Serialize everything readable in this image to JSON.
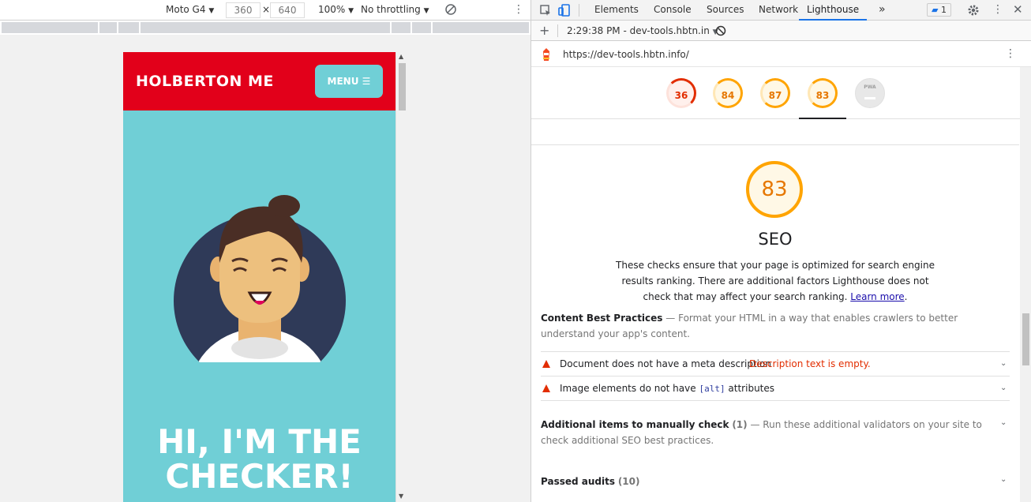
{
  "device_toolbar": {
    "device": "Moto G4",
    "width": "360",
    "times": "×",
    "height": "640",
    "zoom": "100%",
    "throttling": "No throttling"
  },
  "phone": {
    "brand": "HOLBERTON ME",
    "menu_label": "MENU",
    "hero_line1": "HI, I'M THE",
    "hero_line2": "CHECKER!",
    "colors": {
      "header": "#e2001a",
      "body": "#70cfd6"
    }
  },
  "devtools": {
    "tabs": [
      "Elements",
      "Console",
      "Sources",
      "Network",
      "Lighthouse"
    ],
    "active_tab": "Lighthouse",
    "issues_count": "1",
    "report_label": "2:29:38 PM - dev-tools.hbtn.in",
    "url": "https://dev-tools.hbtn.info/",
    "gauges": [
      {
        "value": "36",
        "color": "#e22d00"
      },
      {
        "value": "84",
        "color": "#ffa400"
      },
      {
        "value": "87",
        "color": "#ffa400"
      },
      {
        "value": "83",
        "color": "#ffa400"
      },
      {
        "value": "PWA",
        "color": "#cccccc"
      }
    ],
    "category_score": "83",
    "category_title": "SEO",
    "category_desc": "These checks ensure that your page is optimized for search engine results ranking. There are additional factors Lighthouse does not check that may affect your search ranking.",
    "learn_more": "Learn more",
    "content_best": {
      "title": "Content Best Practices",
      "dash": "—",
      "desc": "Format your HTML in a way that enables crawlers to better understand your app's content."
    },
    "audits": [
      {
        "text": "Document does not have a meta description",
        "extra": "Description text is empty."
      },
      {
        "text_before": "Image elements do not have",
        "code": "[alt]",
        "text_after": "attributes"
      }
    ],
    "manual": {
      "title": "Additional items to manually check",
      "count": "(1)",
      "desc": "— Run these additional validators on your site to check additional SEO best practices."
    },
    "passed": {
      "title": "Passed audits",
      "count": "(10)"
    }
  }
}
